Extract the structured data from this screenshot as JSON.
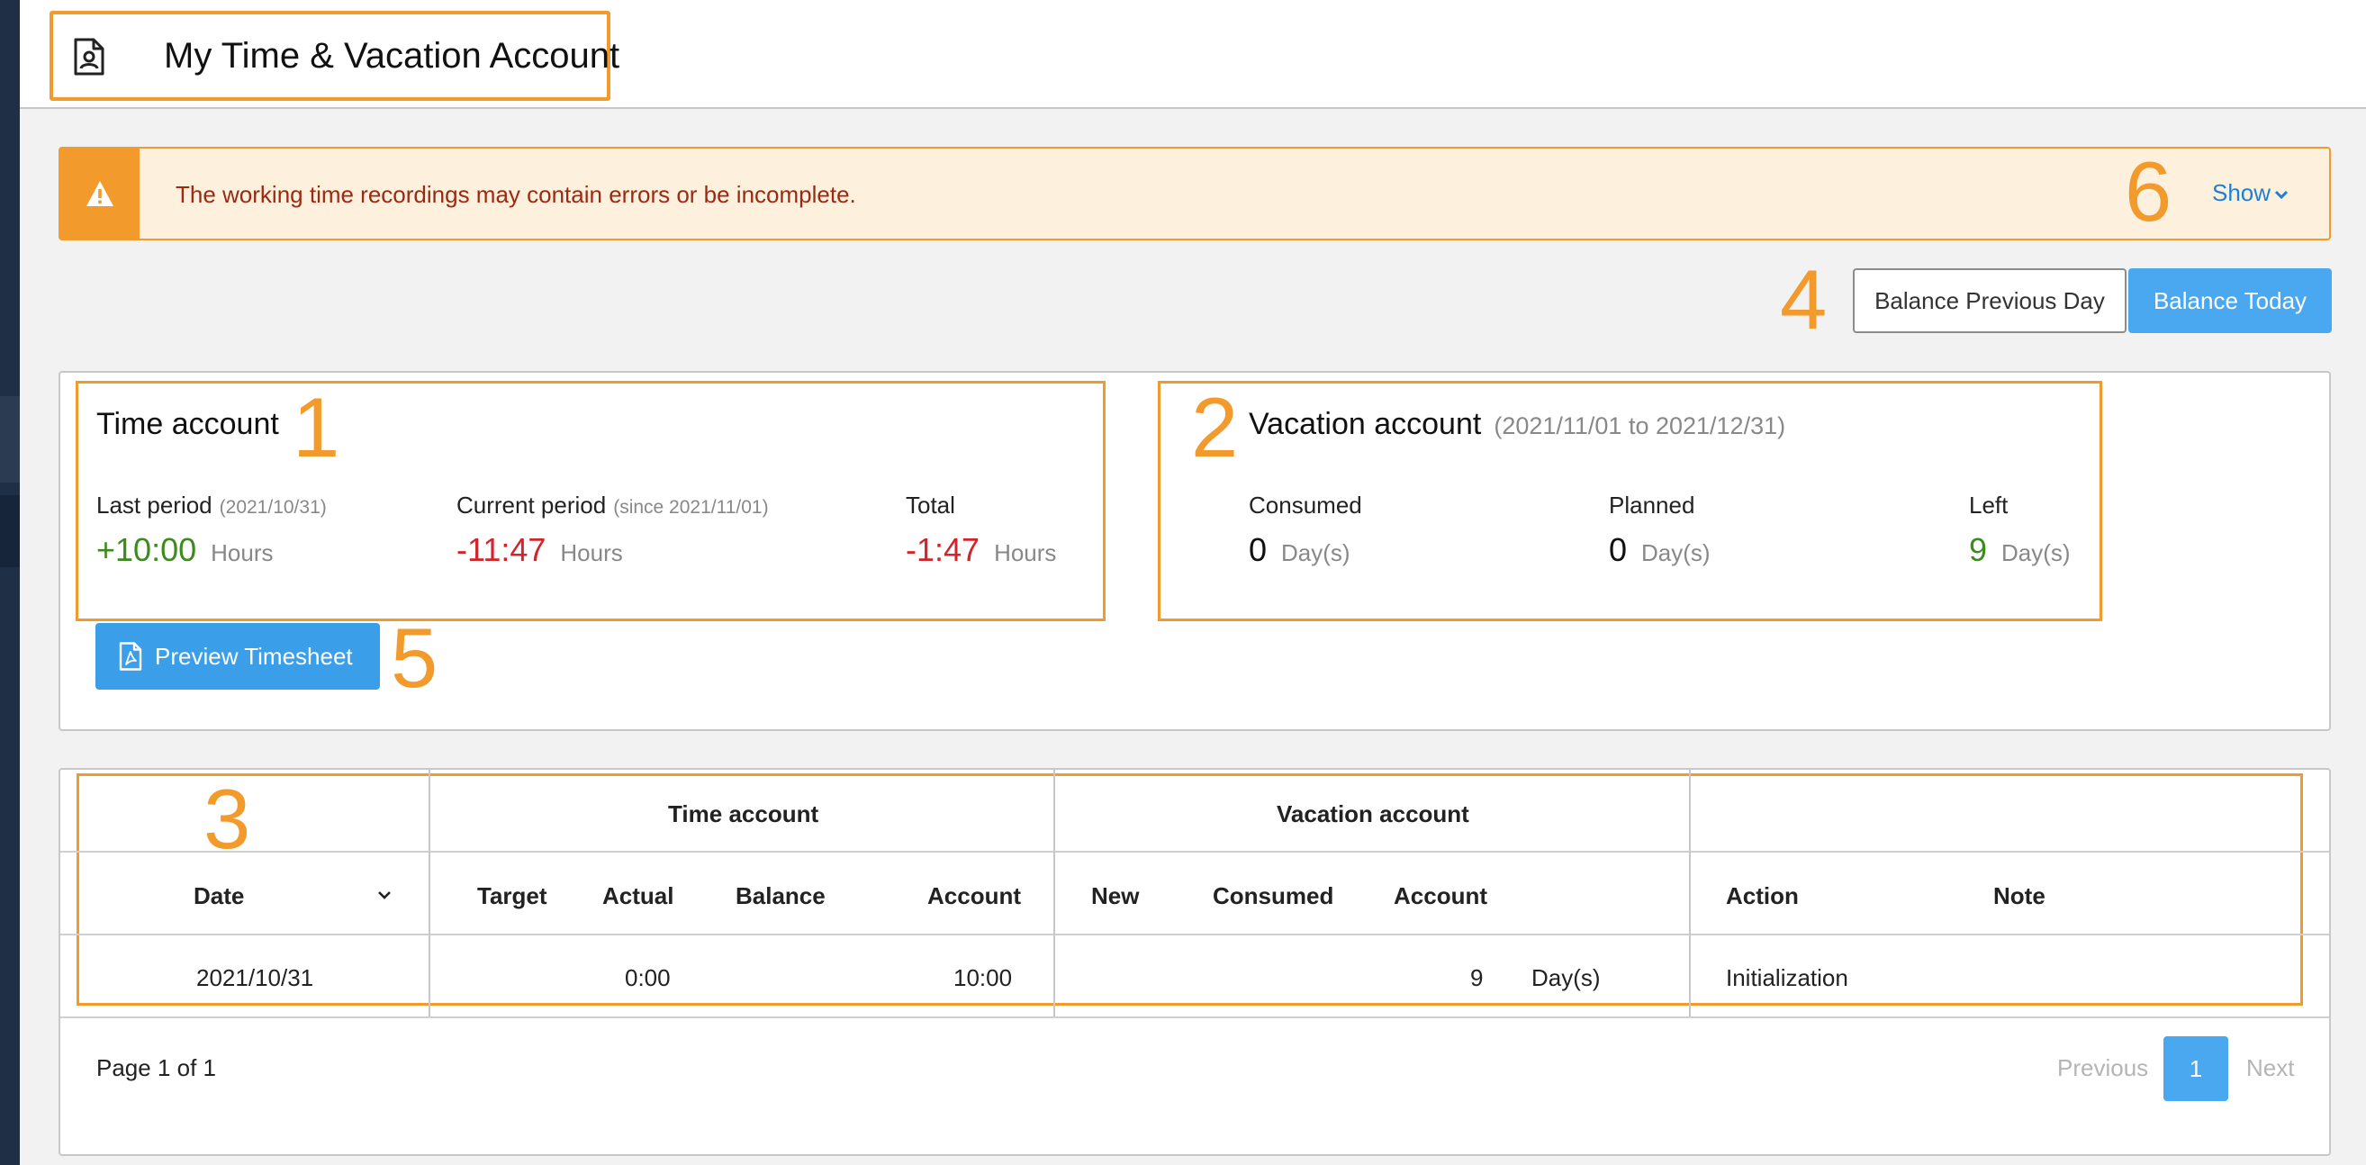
{
  "header": {
    "title": "My Time & Vacation Account",
    "icon": "user-document-icon"
  },
  "alert": {
    "message": "The working time recordings may contain errors or be incomplete.",
    "toggle_label": "Show",
    "icon": "warning-icon",
    "colors": {
      "accent": "#f39a2d",
      "background": "#fdf0dc",
      "text": "#9a2a14"
    }
  },
  "balance_buttons": {
    "previous_label": "Balance Previous Day",
    "today_label": "Balance Today",
    "active": "Balance Today"
  },
  "markers": [
    "1",
    "2",
    "3",
    "4",
    "5",
    "6"
  ],
  "time_account": {
    "title": "Time account",
    "last_period": {
      "label": "Last period",
      "sub": "(2021/10/31)",
      "value": "+10:00",
      "unit": "Hours"
    },
    "current_period": {
      "label": "Current period",
      "sub": "(since 2021/11/01)",
      "value": "-11:47",
      "unit": "Hours"
    },
    "total": {
      "label": "Total",
      "value": "-1:47",
      "unit": "Hours"
    }
  },
  "vacation_account": {
    "title": "Vacation account",
    "range": "(2021/11/01 to 2021/12/31)",
    "consumed": {
      "label": "Consumed",
      "value": "0",
      "unit": "Day(s)"
    },
    "planned": {
      "label": "Planned",
      "value": "0",
      "unit": "Day(s)"
    },
    "left": {
      "label": "Left",
      "value": "9",
      "unit": "Day(s)"
    }
  },
  "preview_button": {
    "label": "Preview Timesheet",
    "icon": "pdf-file-icon"
  },
  "table": {
    "group_headers": {
      "time_account": "Time account",
      "vacation_account": "Vacation account"
    },
    "columns": {
      "date": "Date",
      "target": "Target",
      "actual": "Actual",
      "balance": "Balance",
      "account": "Account",
      "new": "New",
      "consumed": "Consumed",
      "vac_account": "Account",
      "action": "Action",
      "note": "Note"
    },
    "rows": [
      {
        "date": "2021/10/31",
        "target": "",
        "actual": "0:00",
        "balance": "",
        "account": "10:00",
        "new": "",
        "consumed": "",
        "vac_account": "9",
        "vac_unit": "Day(s)",
        "action": "Initialization",
        "note": ""
      }
    ]
  },
  "pagination": {
    "info": "Page 1 of 1",
    "previous": "Previous",
    "current": "1",
    "next": "Next"
  }
}
